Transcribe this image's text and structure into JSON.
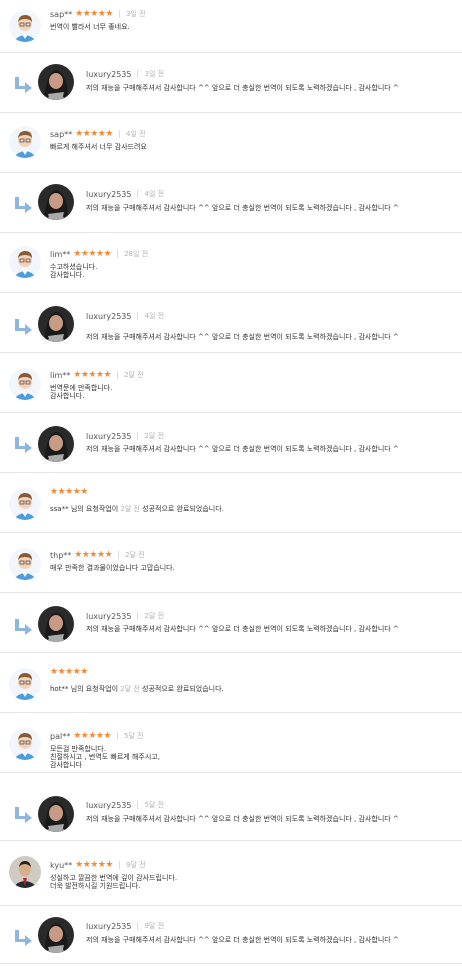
{
  "colors": {
    "star": "#f28a3c",
    "divider": "#e6e6e6",
    "muted": "#b3b3b3"
  },
  "stars_glyph": "★★★★★",
  "reply": {
    "name": "luxury2535",
    "text": "저의 재능을 구매해주셔서 감사합니다 ^^ 앞으로 더 충실한 번역이 되도록 노력하겠습니다 , 감사합니다 ^"
  },
  "reviews": [
    {
      "name": "sap**",
      "time": "3일 전",
      "text": "번역이 빨라서 너무 좋네요."
    },
    {
      "reply_time": "3일 전"
    },
    {
      "name": "sap**",
      "time": "4일 전",
      "text": "빠르게 해주셔서 너무 감사드려요"
    },
    {
      "reply_time": "4일 전"
    },
    {
      "name": "lim**",
      "time": "28일 전",
      "text": "수고하셨습니다.\n감사합니다."
    },
    {
      "reply_time": "4일 전"
    },
    {
      "name": "lim**",
      "time": "2달 전",
      "text": "번역문에 만족합니다.\n감사합니다."
    },
    {
      "reply_time": "2달 전"
    },
    {
      "status_name": "ssa**",
      "status_pre": "님의 요청작업이",
      "status_time": "2달 전",
      "status_post": "성공적으로 완료되었습니다."
    },
    {
      "name": "thp**",
      "time": "2달 전",
      "text": "매우 만족한 결과물이었습니다 고맙습니다."
    },
    {
      "reply_time": "2달 전"
    },
    {
      "status_name": "hot**",
      "status_pre": "님의 요청작업이",
      "status_time": "2달 전",
      "status_post": "성공적으로 완료되었습니다."
    },
    {
      "name": "pal**",
      "time": "5달 전",
      "text": "모든걸 만족합니다.\n친절하시고 , 번역도 빠르게 해주시고,\n감사합니다"
    },
    {
      "reply_time": "5달 전"
    },
    {
      "name": "kyu**",
      "time": "9달 전",
      "text": "성실하고 깔끔한 번역에 깊이 감사드립니다.\n더욱 발전하시길 기원드립니다."
    },
    {
      "reply_time": "9달 전"
    }
  ]
}
